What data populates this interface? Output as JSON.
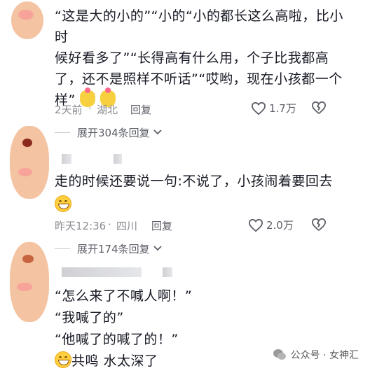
{
  "comments": [
    {
      "text_lines": [
        "“这是大的小的”“小的“小的都长这么高啦，比小时",
        "候好看多了”“长得高有什么用，个子比我都高",
        "了，还不是照样不听话”“哎哟，现在小孩都一个",
        "样”"
      ],
      "emoji": [
        "clap-emoji",
        "clap-emoji"
      ],
      "time": "2天前",
      "location": "湖北",
      "reply_label": "回复",
      "likes": "1.7万",
      "expand_label": "展开304条回复"
    },
    {
      "text_lines": [
        "走的时候还要说一句:不说了，小孩闹着要回去"
      ],
      "emoji": [
        "grin-emoji"
      ],
      "time": "昨天12:36",
      "location": "四川",
      "reply_label": "回复",
      "likes": "2.0万",
      "expand_label": "展开174条回复"
    },
    {
      "text_lines": [
        "“怎么来了不喊人啊！”",
        "“我喊了的”",
        "“他喊了的喊了的！”",
        "共鸣  水太深了"
      ],
      "emoji": [
        "grin-emoji"
      ]
    }
  ],
  "separator": "·",
  "watermark": {
    "text": "公众号 · 女神汇",
    "icon": "wechat-icon"
  },
  "icons": {
    "like": "heart-icon",
    "dislike": "broken-heart-icon",
    "expand": "chevron-down-icon"
  },
  "colors": {
    "text": "#161823",
    "meta": "#8a8b91",
    "avatar": "#f2b891"
  }
}
